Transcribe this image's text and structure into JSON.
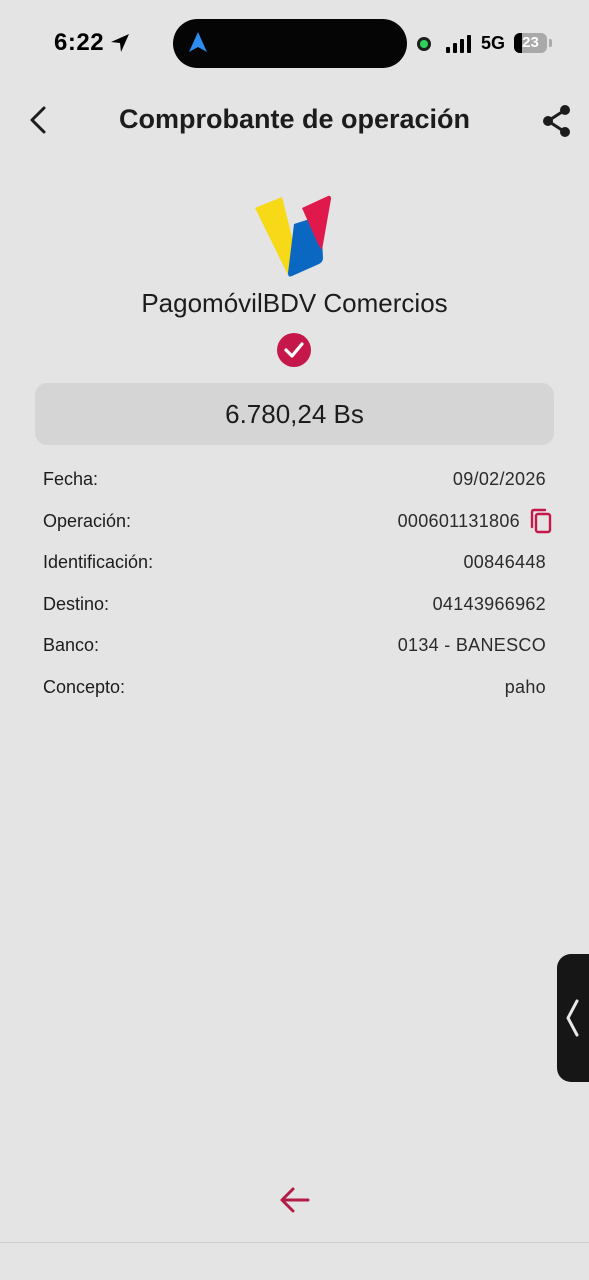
{
  "status_bar": {
    "time": "6:22",
    "network": "5G",
    "battery": "23",
    "icons": [
      "location-arrow-icon",
      "navigation-icon",
      "camera-indicator-icon",
      "signal-icon",
      "battery-icon"
    ]
  },
  "header": {
    "title": "Comprobante de operación",
    "back_icon": "chevron-left-icon",
    "share_icon": "share-icon"
  },
  "brand": {
    "name": "PagomóvilBDV Comercios",
    "logo_colors": [
      "#f7d917",
      "#0a68c2",
      "#e0194c"
    ],
    "success_icon": "check-circle-icon",
    "accent": "#c6174a"
  },
  "amount": "6.780,24 Bs",
  "details": [
    {
      "label": "Fecha:",
      "value": "09/02/2026"
    },
    {
      "label": "Operación:",
      "value": "000601131806"
    },
    {
      "label": "Identificación:",
      "value": "00846448"
    },
    {
      "label": "Destino:",
      "value": "04143966962"
    },
    {
      "label": "Banco:",
      "value": "0134 - BANESCO"
    },
    {
      "label": "Concepto:",
      "value": "paho"
    }
  ],
  "footer": {
    "back_icon": "arrow-left-icon"
  }
}
